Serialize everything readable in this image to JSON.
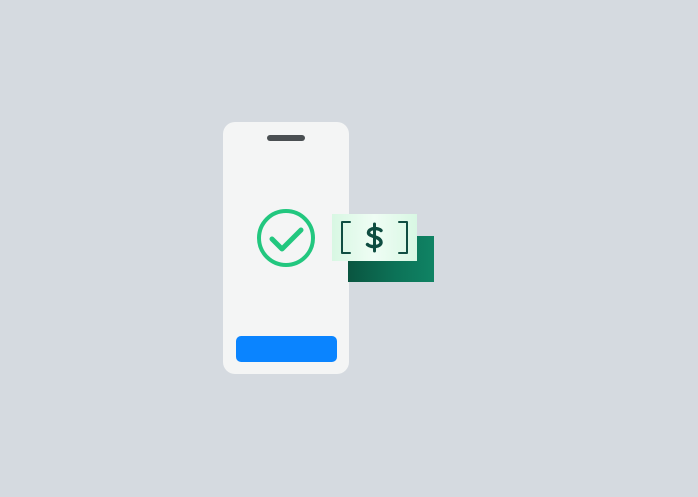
{
  "colors": {
    "background": "#d5dae0",
    "phone_body": "#f4f5f5",
    "phone_speaker": "#4a4f52",
    "check_accent": "#22c77f",
    "action_button": "#0a84ff",
    "bill_front": "#e3fbec",
    "bill_back": "#0c7257",
    "bill_ink": "#0f4d41"
  },
  "icons": {
    "check": "check-circle-icon",
    "currency": "dollar-icon"
  }
}
